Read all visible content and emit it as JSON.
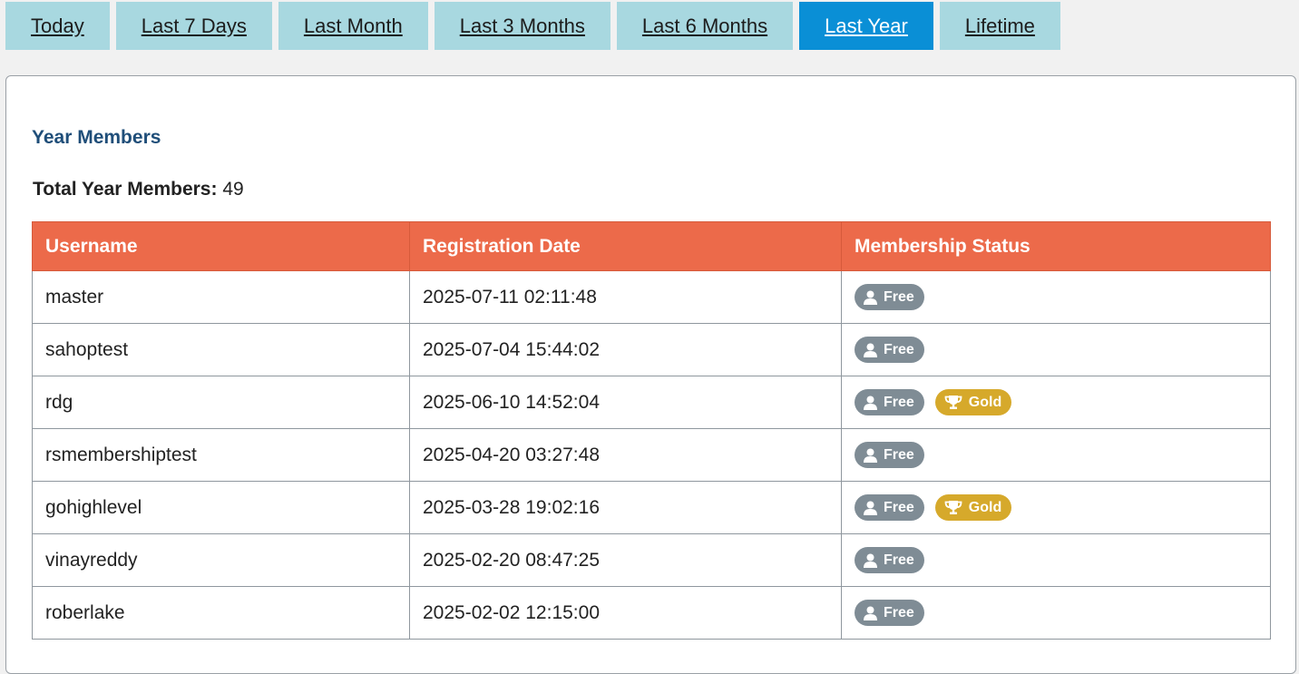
{
  "tabs": [
    {
      "label": "Today",
      "active": false
    },
    {
      "label": "Last 7 Days",
      "active": false
    },
    {
      "label": "Last Month",
      "active": false
    },
    {
      "label": "Last 3 Months",
      "active": false
    },
    {
      "label": "Last 6 Months",
      "active": false
    },
    {
      "label": "Last Year",
      "active": true
    },
    {
      "label": "Lifetime",
      "active": false
    }
  ],
  "section": {
    "title": "Year Members",
    "total_label": "Total Year Members:",
    "total_value": "49"
  },
  "table": {
    "headers": [
      "Username",
      "Registration Date",
      "Membership Status"
    ],
    "rows": [
      {
        "username": "master",
        "date": "2025-07-11 02:11:48",
        "statuses": [
          "Free"
        ]
      },
      {
        "username": "sahoptest",
        "date": "2025-07-04 15:44:02",
        "statuses": [
          "Free"
        ]
      },
      {
        "username": "rdg",
        "date": "2025-06-10 14:52:04",
        "statuses": [
          "Free",
          "Gold"
        ]
      },
      {
        "username": "rsmembershiptest",
        "date": "2025-04-20 03:27:48",
        "statuses": [
          "Free"
        ]
      },
      {
        "username": "gohighlevel",
        "date": "2025-03-28 19:02:16",
        "statuses": [
          "Free",
          "Gold"
        ]
      },
      {
        "username": "vinayreddy",
        "date": "2025-02-20 08:47:25",
        "statuses": [
          "Free"
        ]
      },
      {
        "username": "roberlake",
        "date": "2025-02-02 12:15:00",
        "statuses": [
          "Free"
        ]
      }
    ]
  },
  "colors": {
    "tab_bg": "#a8d8e0",
    "tab_active_bg": "#0a8fd6",
    "header_bg": "#ec6a4a",
    "title_color": "#1f4e79",
    "free_badge": "#7f8c95",
    "gold_badge": "#d6a92b"
  },
  "icons": {
    "Free": "user-icon",
    "Gold": "trophy-icon"
  }
}
